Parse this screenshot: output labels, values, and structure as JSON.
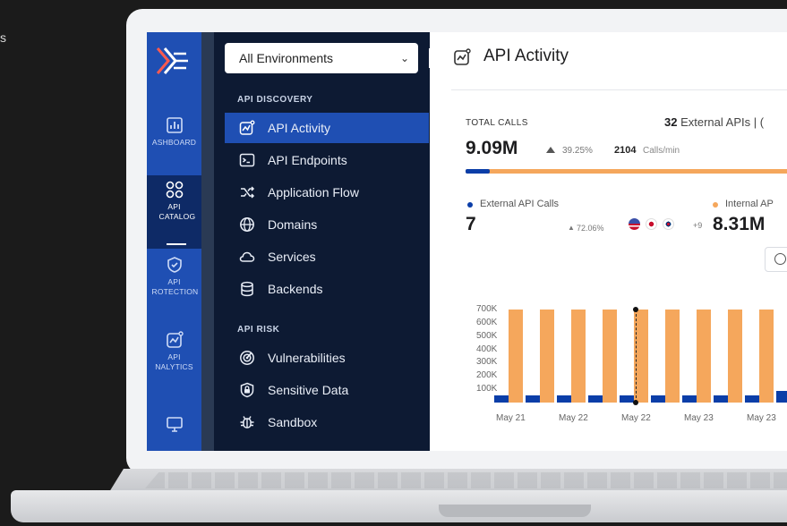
{
  "corner_text": "s",
  "rail": {
    "items": [
      {
        "label": "ASHBOARD",
        "icon": "chart-icon"
      },
      {
        "label": "API CATALOG",
        "icon": "catalog-grid-icon"
      },
      {
        "label": "API ROTECTION",
        "icon": "shield-check-icon"
      },
      {
        "label": "API NALYTICS",
        "icon": "analytics-icon"
      },
      {
        "label": "",
        "icon": "monitor-icon"
      }
    ]
  },
  "menu": {
    "environment": "All Environments",
    "sections": [
      {
        "title": "API DISCOVERY",
        "items": [
          "API Activity",
          "API Endpoints",
          "Application Flow",
          "Domains",
          "Services",
          "Backends"
        ]
      },
      {
        "title": "API RISK",
        "items": [
          "Vulnerabilities",
          "Sensitive Data",
          "Sandbox"
        ]
      }
    ]
  },
  "content": {
    "title": "API Activity",
    "total_calls_label": "TOTAL CALLS",
    "external_apis_count": "32",
    "external_apis_text": "External APIs",
    "external_apis_suffix": "| (",
    "total_calls_value": "9.09M",
    "total_calls_change": "39.25%",
    "calls_per_min_value": "2104",
    "calls_per_min_label": "Calls/min",
    "external_share": 0.07,
    "external_label": "External API Calls",
    "external_value": "7",
    "external_change": "72.06%",
    "internal_label": "Internal AP",
    "internal_value": "8.31M",
    "more_flags": "+9",
    "colors": {
      "external": "#0b3ea8",
      "internal": "#f5a75c",
      "active": "#1f4fb3"
    }
  },
  "chart_data": {
    "type": "bar",
    "y_ticks": [
      "700K",
      "600K",
      "500K",
      "400K",
      "300K",
      "200K",
      "100K"
    ],
    "x_ticks": [
      "May 21",
      "May 22",
      "May 22",
      "May 23",
      "May 23"
    ],
    "ylim": [
      0,
      700000
    ],
    "series": [
      {
        "name": "External API Calls",
        "values": [
          55000,
          55000,
          55000,
          55000,
          55000,
          55000,
          55000,
          55000,
          55000,
          85000,
          170000
        ]
      },
      {
        "name": "Internal AP",
        "values": [
          700000,
          700000,
          700000,
          700000,
          700000,
          700000,
          700000,
          700000,
          700000,
          700000,
          0
        ]
      }
    ]
  }
}
